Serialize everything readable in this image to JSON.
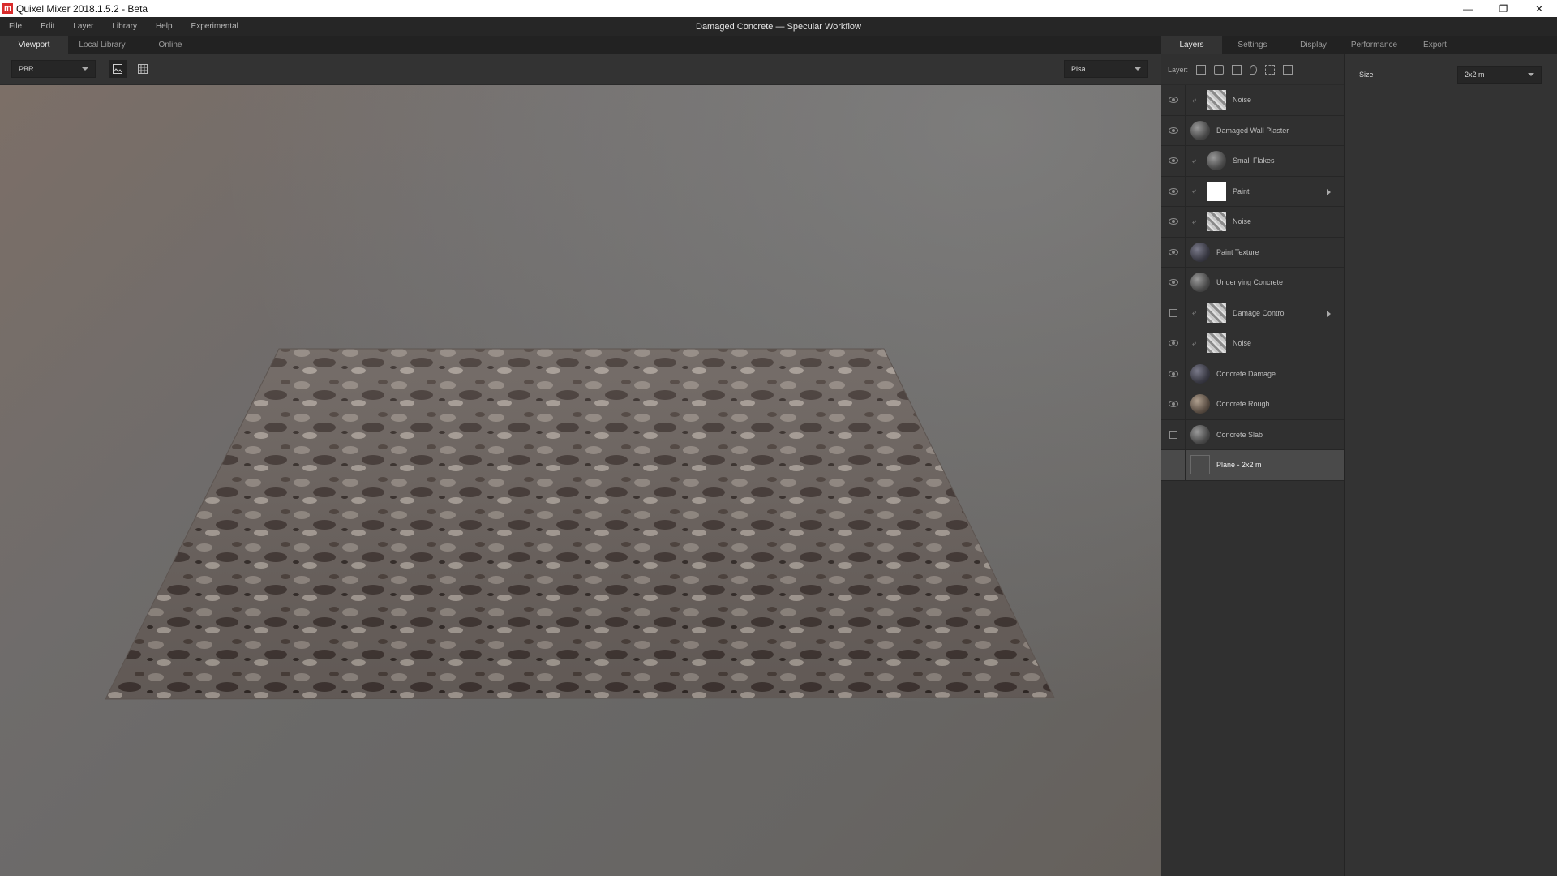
{
  "window": {
    "title": "Quixel Mixer 2018.1.5.2 - Beta",
    "logo_letter": "m",
    "minimize": "—",
    "restore": "❐",
    "close": "✕"
  },
  "menu": [
    "File",
    "Edit",
    "Layer",
    "Library",
    "Help",
    "Experimental"
  ],
  "document_title": "Damaged  Concrete — Specular Workflow",
  "left_tabs": [
    "Viewport",
    "Local Library",
    "Online"
  ],
  "viewport_toolbar": {
    "render_mode": "PBR",
    "environment": "Pisa"
  },
  "right_tabs": [
    "Layers",
    "Settings",
    "Display",
    "Performance",
    "Export"
  ],
  "layers_toolbar_label": "Layer:",
  "layers": [
    {
      "name": "Noise",
      "visibility": "eye",
      "linked": true,
      "thumb": "tex",
      "expandable": false
    },
    {
      "name": "Damaged Wall Plaster",
      "visibility": "eye",
      "linked": false,
      "thumb": "sphere",
      "expandable": false
    },
    {
      "name": "Small Flakes",
      "visibility": "eye",
      "linked": true,
      "thumb": "sphere",
      "expandable": false
    },
    {
      "name": "Paint",
      "visibility": "eye",
      "linked": true,
      "thumb": "white",
      "expandable": true
    },
    {
      "name": "Noise",
      "visibility": "eye",
      "linked": true,
      "thumb": "tex",
      "expandable": false
    },
    {
      "name": "Paint Texture",
      "visibility": "eye",
      "linked": false,
      "thumb": "sphere-dark",
      "expandable": false
    },
    {
      "name": "Underlying Concrete",
      "visibility": "eye",
      "linked": false,
      "thumb": "sphere",
      "expandable": false
    },
    {
      "name": "Damage Control",
      "visibility": "checkbox",
      "linked": true,
      "thumb": "tex",
      "expandable": true
    },
    {
      "name": "Noise",
      "visibility": "eye",
      "linked": true,
      "thumb": "tex",
      "expandable": false
    },
    {
      "name": "Concrete Damage",
      "visibility": "eye",
      "linked": false,
      "thumb": "sphere-dark",
      "expandable": false
    },
    {
      "name": "Concrete Rough",
      "visibility": "eye",
      "linked": false,
      "thumb": "sphere-warm",
      "expandable": false
    },
    {
      "name": "Concrete Slab",
      "visibility": "checkbox",
      "linked": false,
      "thumb": "sphere",
      "expandable": false
    },
    {
      "name": "Plane - 2x2 m",
      "visibility": "none",
      "linked": false,
      "thumb": "empty",
      "expandable": false,
      "selected": true
    }
  ],
  "properties": {
    "size_label": "Size",
    "size_value": "2x2 m"
  },
  "colors": {
    "accent": "#d92b2b",
    "panel": "#303030",
    "selected_row": "#4a4a4a"
  }
}
